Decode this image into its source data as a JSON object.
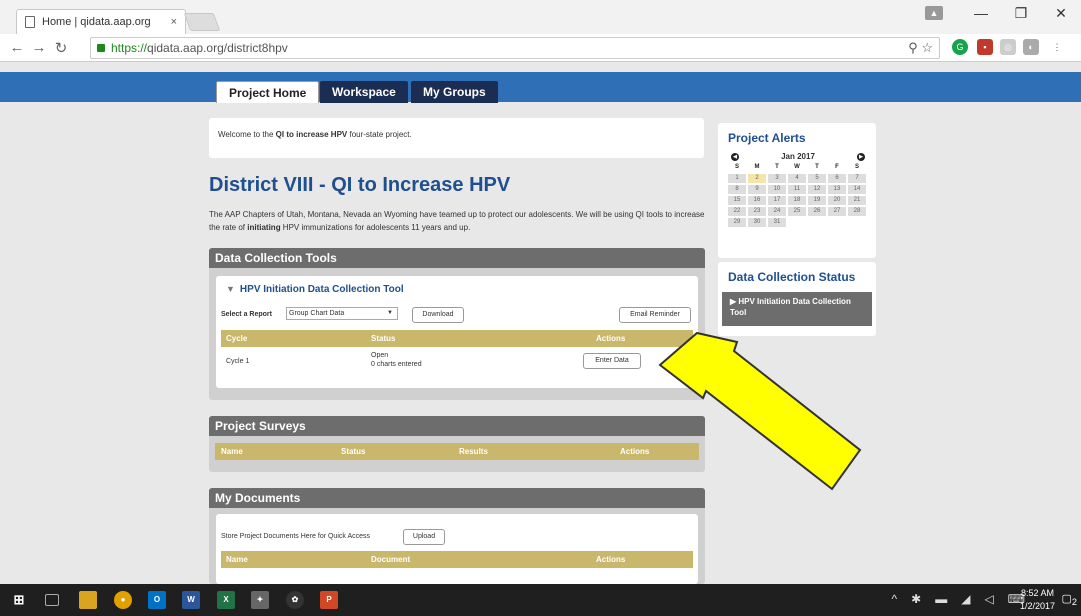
{
  "browser": {
    "tab_title": "Home | qidata.aap.org",
    "tab_close": "×",
    "url_protocol": "https://",
    "url_rest": "qidata.aap.org/district8hpv",
    "window_minimize": "—",
    "window_restore": "❐",
    "window_close": "✕"
  },
  "nav": {
    "tabs": [
      {
        "label": "Project Home"
      },
      {
        "label": "Workspace"
      },
      {
        "label": "My Groups"
      }
    ]
  },
  "welcome": {
    "prefix": "Welcome to the ",
    "bold": "QI to increase HPV",
    "suffix": " four-state project."
  },
  "page_title": "District VIII - QI to Increase HPV",
  "intro": {
    "before": "The AAP Chapters of Utah, Montana, Nevada an Wyoming have teamed up to protect our adolescents. We will be using QI tools to increase the rate of ",
    "bold": "initiating",
    "after": " HPV immunizations for adolescents 11 years and up."
  },
  "data_collection_tools": {
    "heading": "Data Collection Tools",
    "tool_title": "HPV Initiation Data Collection Tool",
    "select_label": "Select a Report",
    "select_value": "Group Chart Data",
    "download_label": "Download",
    "email_reminder_label": "Email Reminder",
    "columns": [
      "Cycle",
      "Status",
      "Actions"
    ],
    "rows": [
      {
        "cycle": "Cycle 1",
        "status_line1": "Open",
        "status_line2": "0 charts entered",
        "action_label": "Enter Data"
      }
    ]
  },
  "project_surveys": {
    "heading": "Project Surveys",
    "columns": [
      "Name",
      "Status",
      "Results",
      "Actions"
    ]
  },
  "my_documents": {
    "heading": "My Documents",
    "store_text": "Store Project Documents Here for Quick Access",
    "upload_label": "Upload",
    "columns": [
      "Name",
      "Document",
      "Actions"
    ]
  },
  "project_alerts": {
    "heading": "Project Alerts",
    "month": "Jan 2017",
    "dow": [
      "S",
      "M",
      "T",
      "W",
      "T",
      "F",
      "S"
    ],
    "weeks": [
      [
        "1",
        "2",
        "3",
        "4",
        "5",
        "6",
        "7"
      ],
      [
        "8",
        "9",
        "10",
        "11",
        "12",
        "13",
        "14"
      ],
      [
        "15",
        "16",
        "17",
        "18",
        "19",
        "20",
        "21"
      ],
      [
        "22",
        "23",
        "24",
        "25",
        "26",
        "27",
        "28"
      ],
      [
        "29",
        "30",
        "31"
      ]
    ],
    "today": "2"
  },
  "data_collection_status": {
    "heading": "Data Collection Status",
    "item": "HPV Initiation Data Collection Tool"
  },
  "taskbar": {
    "time": "8:52 AM",
    "date": "1/2/2017",
    "notifications": "2"
  },
  "colors": {
    "nav_blue": "#2e6fb5",
    "nav_dark": "#1b2d52",
    "title_blue": "#1f4f8f",
    "table_header_gold": "#c9b76b",
    "panel_header_gray": "#6d6d6d",
    "annotation_arrow_yellow": "#ffff00"
  }
}
